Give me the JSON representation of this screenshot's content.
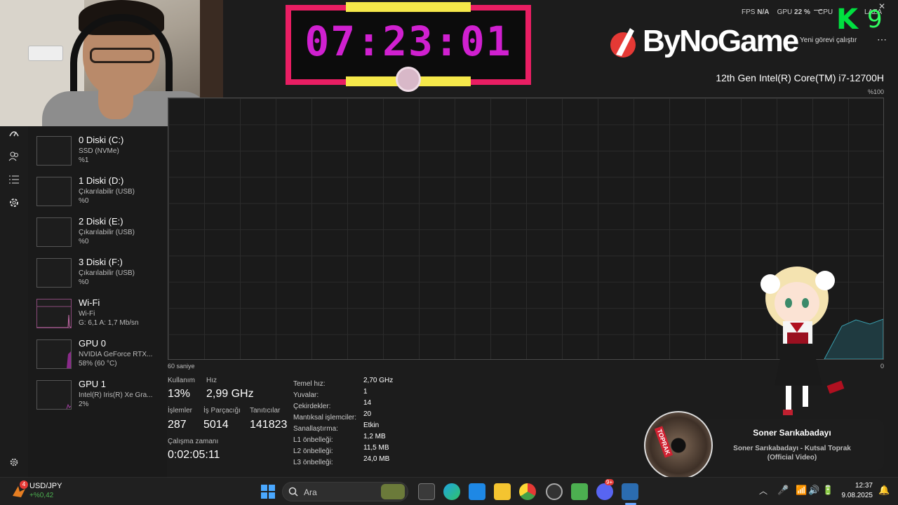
{
  "timer": {
    "time": "07:23:01"
  },
  "brand": {
    "name": "ByNoGame"
  },
  "hud": {
    "fps_label": "FPS",
    "fps_value": "N/A",
    "gpu_label": "GPU",
    "gpu_value": "22 %",
    "cpu_label": "CPU",
    "extra_label": "LA",
    "extra_value": "ZA",
    "k_letter": "K",
    "k_number": "9"
  },
  "taskmgr": {
    "run_task_label": "Yeni görevi çalıştır",
    "cpu_name": "12th Gen Intel(R) Core(TM) i7-12700H",
    "graph": {
      "max_label": "%100",
      "min_label": "0",
      "time_label": "60 saniye"
    },
    "devices": [
      {
        "title": "0 Diski (C:)",
        "sub": "SSD (NVMe)",
        "value": "%1"
      },
      {
        "title": "1 Diski (D:)",
        "sub": "Çıkarılabilir (USB)",
        "value": "%0"
      },
      {
        "title": "2 Diski (E:)",
        "sub": "Çıkarılabilir (USB)",
        "value": "%0"
      },
      {
        "title": "3 Diski (F:)",
        "sub": "Çıkarılabilir (USB)",
        "value": "%0"
      },
      {
        "title": "Wi-Fi",
        "sub": "Wi-Fi",
        "value": "G: 6,1 A: 1,7 Mb/sn"
      },
      {
        "title": "GPU 0",
        "sub": "NVIDIA GeForce RTX...",
        "value": "58% (60 °C)"
      },
      {
        "title": "GPU 1",
        "sub": "Intel(R) Iris(R) Xe Gra...",
        "value": "2%"
      }
    ],
    "stats": {
      "usage_label": "Kullanım",
      "usage_value": "13%",
      "speed_label": "Hız",
      "speed_value": "2,99 GHz",
      "processes_label": "İşlemler",
      "processes_value": "287",
      "threads_label": "İş Parçacığı",
      "threads_value": "5014",
      "handles_label": "Tanıtıcılar",
      "handles_value": "141823",
      "uptime_label": "Çalışma zamanı",
      "uptime_value": "0:02:05:11"
    },
    "specs": [
      {
        "label": "Temel hız:",
        "value": "2,70 GHz"
      },
      {
        "label": "Yuvalar:",
        "value": "1"
      },
      {
        "label": "Çekirdekler:",
        "value": "14"
      },
      {
        "label": "Mantıksal işlemciler:",
        "value": "20"
      },
      {
        "label": "Sanallaştırma:",
        "value": "Etkin"
      },
      {
        "label": "L1 önbelleği:",
        "value": "1,2 MB"
      },
      {
        "label": "L2 önbelleği:",
        "value": "11,5 MB"
      },
      {
        "label": "L3 önbelleği:",
        "value": "24,0 MB"
      }
    ]
  },
  "music": {
    "artist": "Soner Sarıkabadayı",
    "track_line1": "Soner Sarıkabadayı - Kutsal Toprak",
    "track_line2": "(Official Video)",
    "disc_text": "TOPRAK"
  },
  "taskbar": {
    "weather_badge": "4",
    "ticker_name": "USD/JPY",
    "ticker_change": "+%0,42",
    "search_placeholder": "Ara",
    "time": "12:37",
    "date": "9.08.2025",
    "discord_badge": "9+"
  },
  "colors": {
    "accent": "#e91e63",
    "timer_digits": "#d020d0",
    "timer_bars": "#f5e84a",
    "ticker_up": "#4caf50"
  }
}
